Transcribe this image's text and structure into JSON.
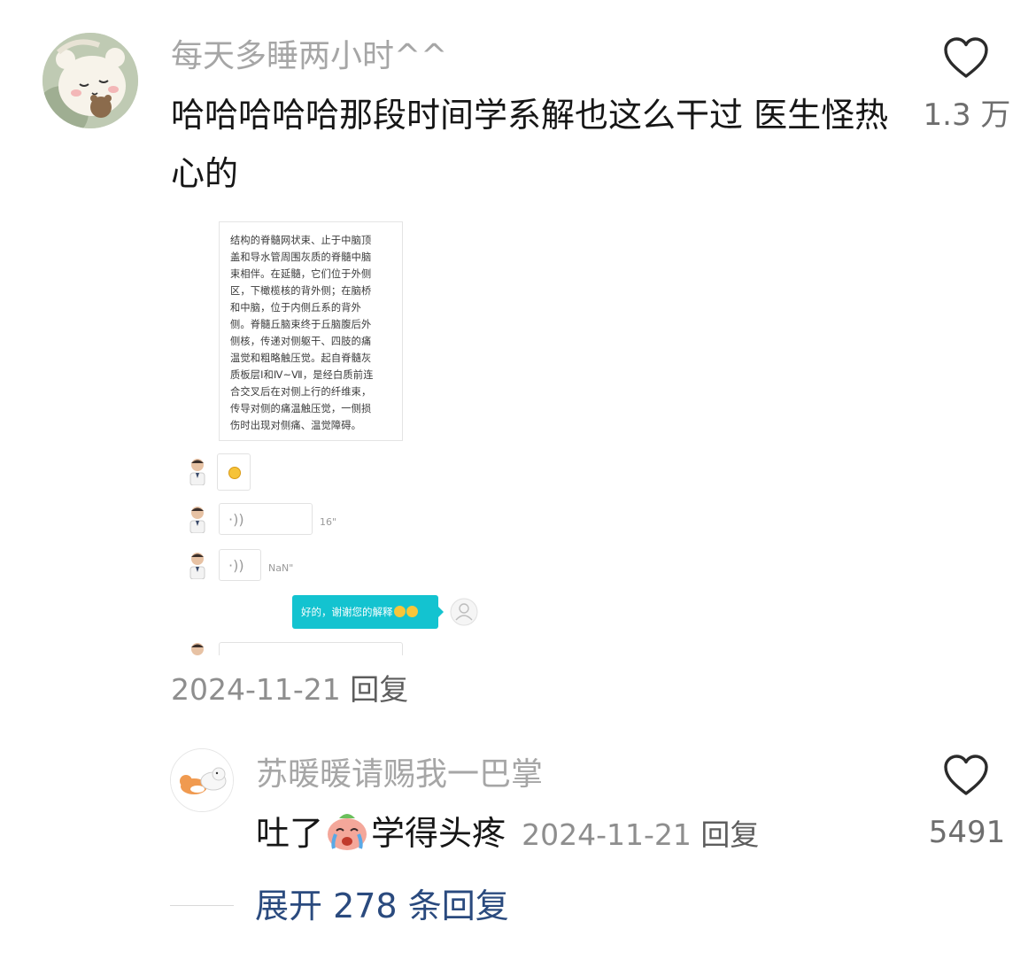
{
  "comments": [
    {
      "username": "每天多睡两小时^^",
      "text": "哈哈哈哈哈那段时间学系解也这么干过 医生怪热心的",
      "date": "2024-11-21",
      "reply_label": "回复",
      "likes": "1.3 万",
      "avatar_icon": "bear-plush-avatar"
    },
    {
      "username": "苏暖暖请赐我一巴掌",
      "text_before": "吐了",
      "text_after": "学得头疼",
      "emoji": "crying-face-emoji",
      "date": "2024-11-21",
      "reply_label": "回复",
      "likes": "5491",
      "avatar_icon": "corgi-cat-avatar"
    }
  ],
  "screenshot": {
    "card_lines": [
      "结构的脊髓网状束、止于中脑顶",
      "盖和导水管周围灰质的脊髓中脑",
      "束相伴。在延髓，它们位于外侧",
      "区，下橄榄核的背外侧；在脑桥",
      "和中脑，位于内侧丘系的背外",
      "侧。脊髓丘脑束终于丘脑腹后外",
      "侧核，传递对侧躯干、四肢的痛",
      "温觉和粗略触压觉。起自脊髓灰",
      "质板层Ⅰ和Ⅳ~Ⅶ，是经白质前连",
      "合交叉后在对侧上行的纤维束，",
      "传导对侧的痛温触压觉，一侧损",
      "伤时出现对侧痛、温觉障碍。"
    ],
    "voice_glyph": "·))",
    "voice1_duration": "16\"",
    "voice2_duration": "NaN\"",
    "my_message": "好的，谢谢您的解释"
  },
  "expand_label": "展开 278 条回复",
  "colors": {
    "username": "#a6a6a6",
    "expand_link": "#2a4a7e",
    "chat_bubble": "#13c3d0"
  }
}
